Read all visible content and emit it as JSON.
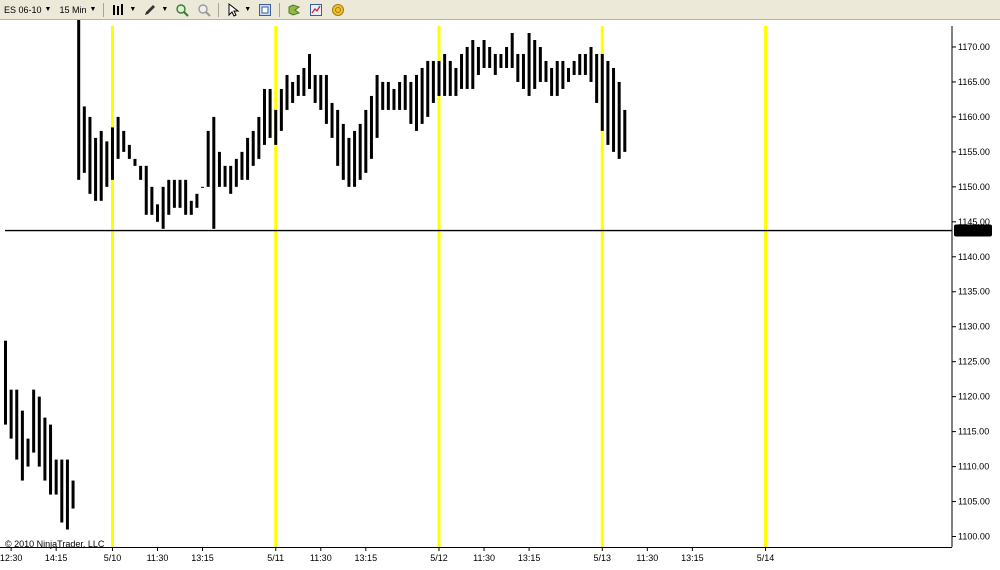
{
  "toolbar": {
    "instrument": "ES 06-10",
    "interval": "15 Min"
  },
  "copyright": "© 2010 NinjaTrader, LLC",
  "last_price_label": "1143.75",
  "colors": {
    "session_line": "#ffff00",
    "bar": "#000000",
    "price_line": "#000000",
    "background": "#ffffff",
    "toolbar": "#ece9d8"
  },
  "chart_data": {
    "type": "bar",
    "title": "",
    "xlabel": "",
    "ylabel": "",
    "ylim": [
      1098.5,
      1173
    ],
    "yticks": [
      1100,
      1105,
      1110,
      1115,
      1120,
      1125,
      1130,
      1135,
      1140,
      1145,
      1150,
      1155,
      1160,
      1165,
      1170
    ],
    "ytick_labels": [
      "1100.00",
      "1105.00",
      "1110.00",
      "1115.00",
      "1120.00",
      "1125.00",
      "1130.00",
      "1135.00",
      "1140.00",
      "1145.00",
      "1150.00",
      "1155.00",
      "1160.00",
      "1165.00",
      "1170.00"
    ],
    "xtick_labels": [
      "12:30",
      "14:15",
      "5/10",
      "11:30",
      "13:15",
      "5/11",
      "11:30",
      "13:15",
      "5/12",
      "11:30",
      "13:15",
      "5/13",
      "11:30",
      "13:15",
      "5/14"
    ],
    "xtick_bar_index": [
      1,
      9,
      19,
      27,
      35,
      48,
      56,
      64,
      77,
      85,
      93,
      106,
      114,
      122,
      135
    ],
    "session_separator_bar_index": [
      19,
      48,
      77,
      106,
      135
    ],
    "horizontal_line": 1143.75,
    "grid": false,
    "series": [
      {
        "high": [
          1128,
          1121,
          1121,
          1118,
          1114,
          1121,
          1120,
          1117,
          1116,
          1111,
          1111,
          1111,
          1108,
          1192.1,
          1161.5,
          1160,
          1157,
          1158,
          1156.5,
          1158.5,
          1160,
          1158,
          1156,
          1154,
          1153,
          1153,
          1150,
          1147.5,
          1150,
          1151,
          1151,
          1151,
          1151,
          1148,
          1149,
          1150,
          1158,
          1160,
          1155,
          1153,
          1153,
          1154,
          1155,
          1157,
          1158,
          1160,
          1164,
          1164,
          1161,
          1164,
          1166,
          1165,
          1166,
          1167,
          1169,
          1166,
          1166,
          1166,
          1162,
          1161,
          1159,
          1157,
          1158,
          1159,
          1161,
          1163,
          1166,
          1165,
          1165,
          1164,
          1165,
          1166,
          1165,
          1166,
          1167,
          1168,
          1168,
          1168,
          1169,
          1168,
          1167,
          1169,
          1170,
          1171,
          1170,
          1171,
          1170,
          1169,
          1169,
          1170,
          1172,
          1169,
          1169,
          1172,
          1171,
          1170,
          1168,
          1167,
          1168,
          1168,
          1167,
          1168,
          1169,
          1169,
          1170,
          1169,
          1169,
          1168,
          1167,
          1165,
          1161,
          1162,
          1160,
          1157
        ],
        "low": [
          1116,
          1114,
          1111,
          1108,
          1110,
          1112,
          1110,
          1108,
          1106,
          1106,
          1102,
          1101,
          1104,
          1151,
          1152,
          1149,
          1148,
          1148,
          1150,
          1151,
          1154,
          1155,
          1154,
          1153,
          1151,
          1146,
          1146,
          1145,
          1144,
          1146,
          1147,
          1147,
          1146,
          1146,
          1147,
          1150,
          1150,
          1144,
          1150,
          1150,
          1149,
          1150,
          1151,
          1151,
          1153,
          1154,
          1156,
          1157,
          1156,
          1158,
          1161,
          1162,
          1163,
          1163,
          1164,
          1162,
          1161,
          1159,
          1157,
          1153,
          1151,
          1150,
          1150,
          1151,
          1152,
          1154,
          1157,
          1161,
          1161,
          1161,
          1161,
          1161,
          1159,
          1158,
          1159,
          1160,
          1162,
          1163,
          1163,
          1163,
          1163,
          1164,
          1164,
          1164,
          1166,
          1167,
          1167,
          1166,
          1167,
          1167,
          1167,
          1165,
          1164,
          1163,
          1164,
          1165,
          1165,
          1163,
          1163,
          1164,
          1165,
          1166,
          1166,
          1166,
          1165,
          1162,
          1158,
          1156,
          1155,
          1154,
          1155
        ],
        "_note": "not visible"
      }
    ]
  }
}
